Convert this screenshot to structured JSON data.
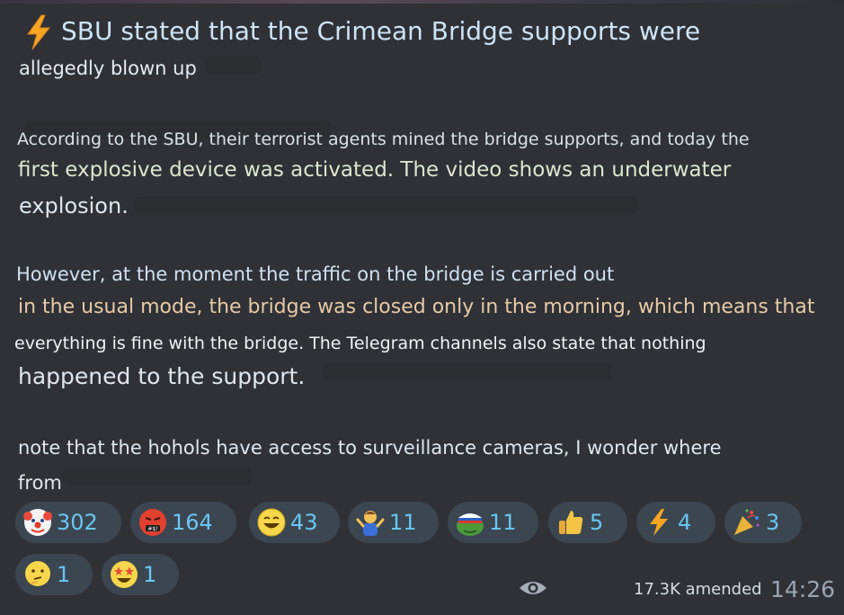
{
  "post": {
    "title": "SBU stated that the Crimean Bridge supports were",
    "lines": [
      "allegedly blown up",
      "According to the SBU, their terrorist agents mined the bridge supports, and today the",
      "first explosive device was activated. The video shows an underwater",
      "explosion.",
      "However, at the moment the traffic on the bridge is carried out",
      "in the usual mode, the bridge was closed only in the morning, which means that",
      "everything is fine with the bridge. The Telegram channels also state that nothing",
      "happened to the support.",
      "note that the hohols have access to surveillance cameras, I wonder where",
      "from"
    ],
    "title_icon": "lightning-icon"
  },
  "reactions": [
    {
      "icon": "clown-face-icon",
      "count": "302"
    },
    {
      "icon": "cursing-face-icon",
      "count": "164"
    },
    {
      "icon": "grinning-face-icon",
      "count": "43"
    },
    {
      "icon": "person-shrugging-icon",
      "count": "11"
    },
    {
      "icon": "frog-meme-icon",
      "count": "11"
    },
    {
      "icon": "thumbs-up-icon",
      "count": "5"
    },
    {
      "icon": "lightning-icon",
      "count": "4"
    },
    {
      "icon": "party-popper-icon",
      "count": "3"
    },
    {
      "icon": "thinking-face-icon",
      "count": "1"
    },
    {
      "icon": "star-struck-icon",
      "count": "1"
    }
  ],
  "footer": {
    "views_icon": "eye-icon",
    "views_text": "17.3K amended",
    "time": "14:26"
  },
  "colors": {
    "background": "#2f3136",
    "reaction_bg": "#3c4650",
    "reaction_count": "#68c6f2",
    "title": "#cde3f7"
  }
}
